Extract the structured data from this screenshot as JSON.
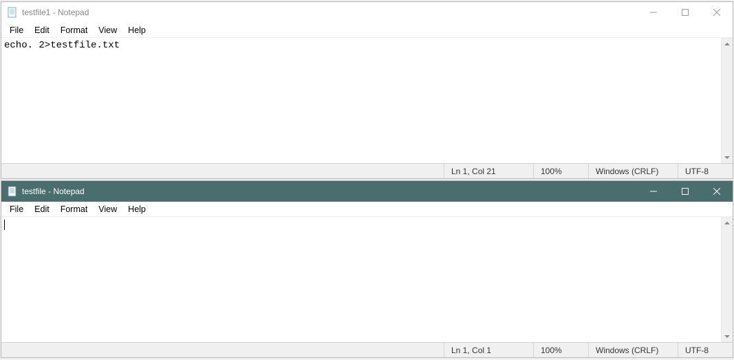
{
  "window1": {
    "title": "testfile1 - Notepad",
    "menu": {
      "file": "File",
      "edit": "Edit",
      "format": "Format",
      "view": "View",
      "help": "Help"
    },
    "content": "echo. 2>testfile.txt",
    "status": {
      "position": "Ln 1, Col 21",
      "zoom": "100%",
      "line_ending": "Windows (CRLF)",
      "encoding": "UTF-8"
    }
  },
  "window2": {
    "title": "testfile - Notepad",
    "menu": {
      "file": "File",
      "edit": "Edit",
      "format": "Format",
      "view": "View",
      "help": "Help"
    },
    "content": "",
    "status": {
      "position": "Ln 1, Col 1",
      "zoom": "100%",
      "line_ending": "Windows (CRLF)",
      "encoding": "UTF-8"
    }
  }
}
